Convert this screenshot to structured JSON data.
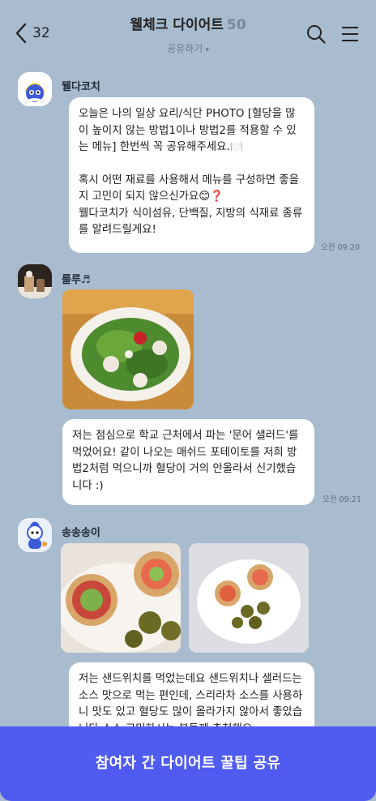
{
  "header": {
    "back_count": "32",
    "title": "웰체크 다이어트",
    "member_count": "50",
    "share_label": "공유하기",
    "share_caret": "▾"
  },
  "messages": [
    {
      "sender": "웰다코치",
      "paragraphs": [
        "오늘은 나의 일상 요리/식단 PHOTO [혈당을 많이 높이지 않는 방법1이나 방법2를 적용할 수 있는 메뉴] 한번씩 꼭 공유해주세요.🍽️",
        "",
        "혹시 어떤 재료를 사용해서 메뉴를 구성하면 좋을지 고민이 되지 않으신가요😊❓",
        "웰다코치가 식이섬유, 단백질, 지방의 식재료 종류를 알려드릴게요!"
      ],
      "time": "오전 09:20"
    },
    {
      "sender": "룰루♬",
      "text": "저는 점심으로 학교 근처에서 파는 '문어 샐러드'를 먹었어요! 같이 나오는 매쉬드 포테이토를 저희 방법2처럼 먹으니까 혈당이 거의 안올라서 신기했습니다 :)",
      "time": "오전 09:21"
    },
    {
      "sender": "송송송이",
      "text": "저는 샌드위치를 먹었는데요 샌드위치나 샐러드는 소스 맛으로 먹는 편인데, 스리라차 소스를 사용하니 맛도 있고 혈당도 많이 올라가지 않아서 좋았습니다 소스 고민하시는 분들께 추천해요"
    }
  ],
  "cta": {
    "label": "참여자 간 다이어트 꿀팁 공유"
  },
  "colors": {
    "background": "#a9bbcf",
    "cta": "#4f5bf1",
    "bubble": "#ffffff"
  }
}
